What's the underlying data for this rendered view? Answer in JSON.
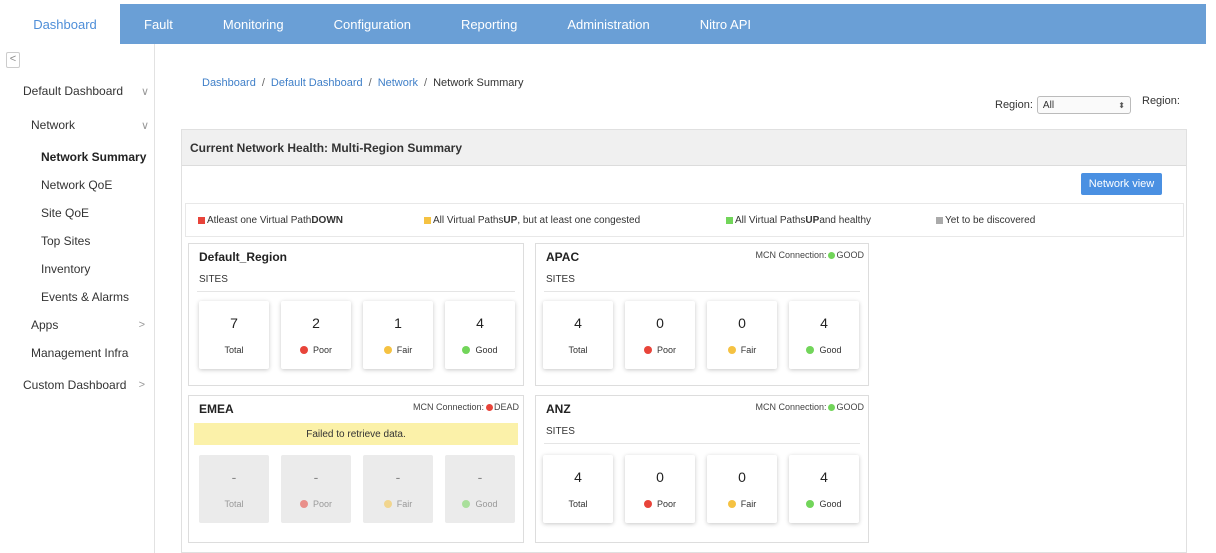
{
  "colors": {
    "nav_bg": "#6a9fd6",
    "accent": "#4a90e2",
    "down": "#e8443a",
    "congested": "#f5c242",
    "healthy": "#72d55a",
    "undiscovered": "#aaaaaa"
  },
  "nav": {
    "tabs": [
      "Dashboard",
      "Fault",
      "Monitoring",
      "Configuration",
      "Reporting",
      "Administration",
      "Nitro API"
    ],
    "active": "Dashboard"
  },
  "sidebar": {
    "collapse_icon": "chevron-left-icon",
    "collapse_glyph": "<",
    "items": [
      {
        "label": "Default Dashboard",
        "chevron": "∨"
      },
      {
        "label": "Network",
        "chevron": "∨"
      },
      {
        "label": "Network Summary"
      },
      {
        "label": "Network QoE"
      },
      {
        "label": "Site QoE"
      },
      {
        "label": "Top Sites"
      },
      {
        "label": "Inventory"
      },
      {
        "label": "Events & Alarms"
      },
      {
        "label": "Apps",
        "chevron": ">"
      },
      {
        "label": "Management Infra"
      },
      {
        "label": "Custom Dashboard",
        "chevron": ">"
      }
    ]
  },
  "breadcrumb": {
    "items": [
      "Dashboard",
      "Default Dashboard",
      "Network",
      "Network Summary"
    ],
    "separator": "/"
  },
  "region_filter": {
    "label": "Region:",
    "value": "All",
    "arrow": "⬍",
    "label2": "Region:"
  },
  "panel": {
    "title": "Current Network Health: Multi-Region Summary",
    "network_view_button": "Network view"
  },
  "legend": [
    {
      "pre": "Atleast one Virtual Path ",
      "bold": "DOWN",
      "post": ""
    },
    {
      "pre": "All Virtual Paths ",
      "bold": "UP",
      "post": ", but at least one congested"
    },
    {
      "pre": "All Virtual Paths ",
      "bold": "UP",
      "post": " and healthy"
    },
    {
      "pre": "Yet to be discovered",
      "bold": "",
      "post": ""
    }
  ],
  "regions": [
    {
      "name": "Default_Region",
      "mcn_label": "",
      "mcn_status": "",
      "sites_label": "SITES",
      "stats": {
        "total": "7",
        "poor": "2",
        "fair": "1",
        "good": "4"
      }
    },
    {
      "name": "APAC",
      "mcn_label": "MCN Connection:",
      "mcn_status": "GOOD",
      "sites_label": "SITES",
      "stats": {
        "total": "4",
        "poor": "0",
        "fair": "0",
        "good": "4"
      }
    },
    {
      "name": "EMEA",
      "mcn_label": "MCN Connection:",
      "mcn_status": "DEAD",
      "error": "Failed to retrieve data.",
      "stats": {
        "total": "-",
        "poor": "-",
        "fair": "-",
        "good": "-"
      }
    },
    {
      "name": "ANZ",
      "mcn_label": "MCN Connection:",
      "mcn_status": "GOOD",
      "sites_label": "SITES",
      "stats": {
        "total": "4",
        "poor": "0",
        "fair": "0",
        "good": "4"
      }
    }
  ],
  "stat_labels": {
    "total": "Total",
    "poor": "Poor",
    "fair": "Fair",
    "good": "Good"
  }
}
